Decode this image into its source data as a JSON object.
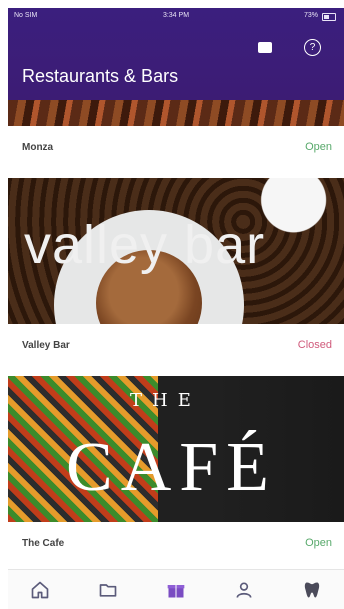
{
  "status_bar": {
    "carrier": "No SIM ",
    "time": "3:34 PM",
    "battery": "73%"
  },
  "header": {
    "title": "Restaurants & Bars",
    "icons": [
      "chat-icon",
      "help-icon"
    ]
  },
  "venues": [
    {
      "name": "Monza",
      "status": "Open"
    },
    {
      "name": "Valley Bar",
      "status": "Closed",
      "image_text": "valley bar"
    },
    {
      "name": "The Cafe",
      "status": "Open",
      "image_text_top": "THE",
      "image_text_main": "CAFÉ"
    }
  ],
  "tabbar": {
    "icons": [
      "home-icon",
      "folder-icon",
      "gift-icon",
      "user-icon",
      "tooth-icon"
    ],
    "active_index": 2,
    "accent": "#7a4cc2"
  },
  "colors": {
    "header_bg": "#3b1f7e",
    "open": "#58a96b",
    "closed": "#d05a7b"
  }
}
